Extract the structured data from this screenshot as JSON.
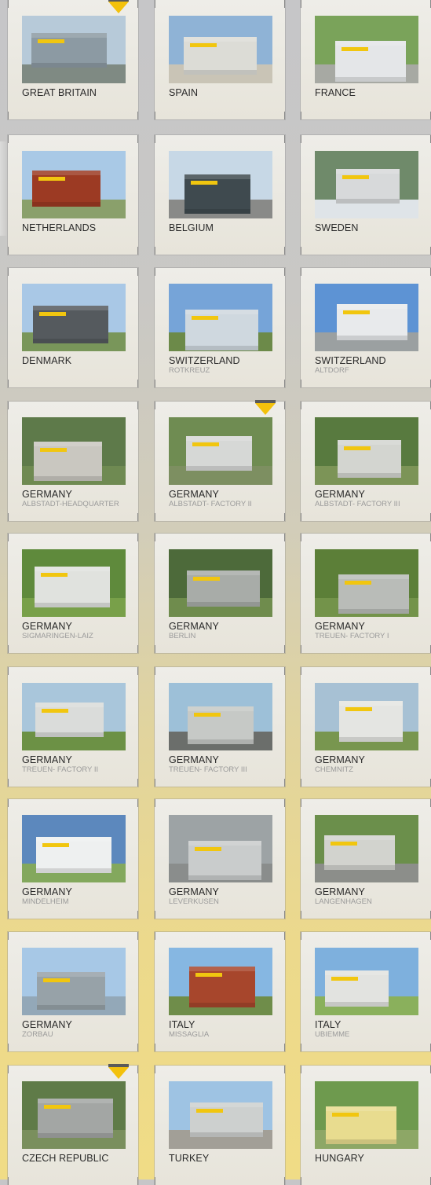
{
  "locations": [
    {
      "country": "GREAT BRITAIN",
      "city": "",
      "marker": true,
      "palette": {
        "sky": "#b7cad9",
        "bldg": "#8c9aa3",
        "ground": "#7f8a83"
      }
    },
    {
      "country": "SPAIN",
      "city": "",
      "marker": false,
      "palette": {
        "sky": "#8fb3d6",
        "bldg": "#dcdcd6",
        "ground": "#c9c4b6"
      }
    },
    {
      "country": "FRANCE",
      "city": "",
      "marker": false,
      "palette": {
        "sky": "#7aa35a",
        "bldg": "#e4e6e8",
        "ground": "#a7a9a3"
      }
    },
    {
      "country": "NETHERLANDS",
      "city": "",
      "marker": false,
      "palette": {
        "sky": "#a9c9e6",
        "bldg": "#9c3a23",
        "ground": "#8aa06b"
      }
    },
    {
      "country": "BELGIUM",
      "city": "",
      "marker": false,
      "palette": {
        "sky": "#c7d8e6",
        "bldg": "#3f4a4f",
        "ground": "#898a88"
      }
    },
    {
      "country": "SWEDEN",
      "city": "",
      "marker": false,
      "palette": {
        "sky": "#6f8a6a",
        "bldg": "#d7d9da",
        "ground": "#dfe4e8"
      }
    },
    {
      "country": "DENMARK",
      "city": "",
      "marker": false,
      "palette": {
        "sky": "#a9c8e6",
        "bldg": "#555a5e",
        "ground": "#79965a"
      }
    },
    {
      "country": "SWITZERLAND",
      "city": "ROTKREUZ",
      "marker": false,
      "palette": {
        "sky": "#76a4d8",
        "bldg": "#cfd8df",
        "ground": "#6c8a49"
      }
    },
    {
      "country": "SWITZERLAND",
      "city": "ALTDORF",
      "marker": false,
      "palette": {
        "sky": "#5d93d4",
        "bldg": "#e8eaec",
        "ground": "#9ba0a1"
      }
    },
    {
      "country": "GERMANY",
      "city": "ALBSTADT-HEADQUARTER",
      "marker": false,
      "palette": {
        "sky": "#5e7a4a",
        "bldg": "#c9c7c0",
        "ground": "#6f8a52"
      }
    },
    {
      "country": "GERMANY",
      "city": "ALBSTADT- FACTORY II",
      "marker": true,
      "palette": {
        "sky": "#6f8c52",
        "bldg": "#d6d8d6",
        "ground": "#7d8f61"
      }
    },
    {
      "country": "GERMANY",
      "city": "ALBSTADT- FACTORY III",
      "marker": false,
      "palette": {
        "sky": "#587a3f",
        "bldg": "#d3d5d0",
        "ground": "#7c9457"
      }
    },
    {
      "country": "GERMANY",
      "city": "SIGMARINGEN-LAIZ",
      "marker": false,
      "palette": {
        "sky": "#5f8a3c",
        "bldg": "#e0e2de",
        "ground": "#78a049"
      }
    },
    {
      "country": "GERMANY",
      "city": "BERLIN",
      "marker": false,
      "palette": {
        "sky": "#4d6a3a",
        "bldg": "#a8aca8",
        "ground": "#6f8c4d"
      }
    },
    {
      "country": "GERMANY",
      "city": "TREUEN- FACTORY I",
      "marker": false,
      "palette": {
        "sky": "#5c7f38",
        "bldg": "#b9bcb8",
        "ground": "#73934a"
      }
    },
    {
      "country": "GERMANY",
      "city": "TREUEN- FACTORY II",
      "marker": false,
      "palette": {
        "sky": "#a9c6db",
        "bldg": "#dadcda",
        "ground": "#6c9145"
      }
    },
    {
      "country": "GERMANY",
      "city": "TREUEN- FACTORY III",
      "marker": false,
      "palette": {
        "sky": "#9dc0d8",
        "bldg": "#c6c9c6",
        "ground": "#6b6e6b"
      }
    },
    {
      "country": "GERMANY",
      "city": "CHEMNITZ",
      "marker": false,
      "palette": {
        "sky": "#a7c1d4",
        "bldg": "#e4e5e2",
        "ground": "#78964f"
      }
    },
    {
      "country": "GERMANY",
      "city": "MINDELHEIM",
      "marker": false,
      "palette": {
        "sky": "#5c88bd",
        "bldg": "#eef0f0",
        "ground": "#83a85d"
      }
    },
    {
      "country": "GERMANY",
      "city": "LEVERKUSEN",
      "marker": false,
      "palette": {
        "sky": "#9da3a5",
        "bldg": "#c9cccc",
        "ground": "#8a8d8c"
      }
    },
    {
      "country": "GERMANY",
      "city": "LANGENHAGEN",
      "marker": false,
      "palette": {
        "sky": "#6b8f4b",
        "bldg": "#d2d3ce",
        "ground": "#8c8e8a"
      }
    },
    {
      "country": "GERMANY",
      "city": "ZORBAU",
      "marker": false,
      "palette": {
        "sky": "#a7c8e6",
        "bldg": "#97a2a8",
        "ground": "#93a8b8"
      }
    },
    {
      "country": "ITALY",
      "city": "MISSAGLIA",
      "marker": false,
      "palette": {
        "sky": "#86b7e2",
        "bldg": "#a7462c",
        "ground": "#6f8d4a"
      }
    },
    {
      "country": "ITALY",
      "city": "UBIEMME",
      "marker": false,
      "palette": {
        "sky": "#7eb0dd",
        "bldg": "#e2e3e0",
        "ground": "#8ab05c"
      }
    },
    {
      "country": "CZECH REPUBLIC",
      "city": "",
      "marker": true,
      "palette": {
        "sky": "#5f7b48",
        "bldg": "#a3a6a4",
        "ground": "#7a8f5d"
      }
    },
    {
      "country": "TURKEY",
      "city": "",
      "marker": false,
      "palette": {
        "sky": "#9ec3e3",
        "bldg": "#cdd0cf",
        "ground": "#a29f97"
      }
    },
    {
      "country": "HUNGARY",
      "city": "",
      "marker": false,
      "palette": {
        "sky": "#6e9a4e",
        "bldg": "#e8dc8f",
        "ground": "#8da766"
      }
    }
  ]
}
